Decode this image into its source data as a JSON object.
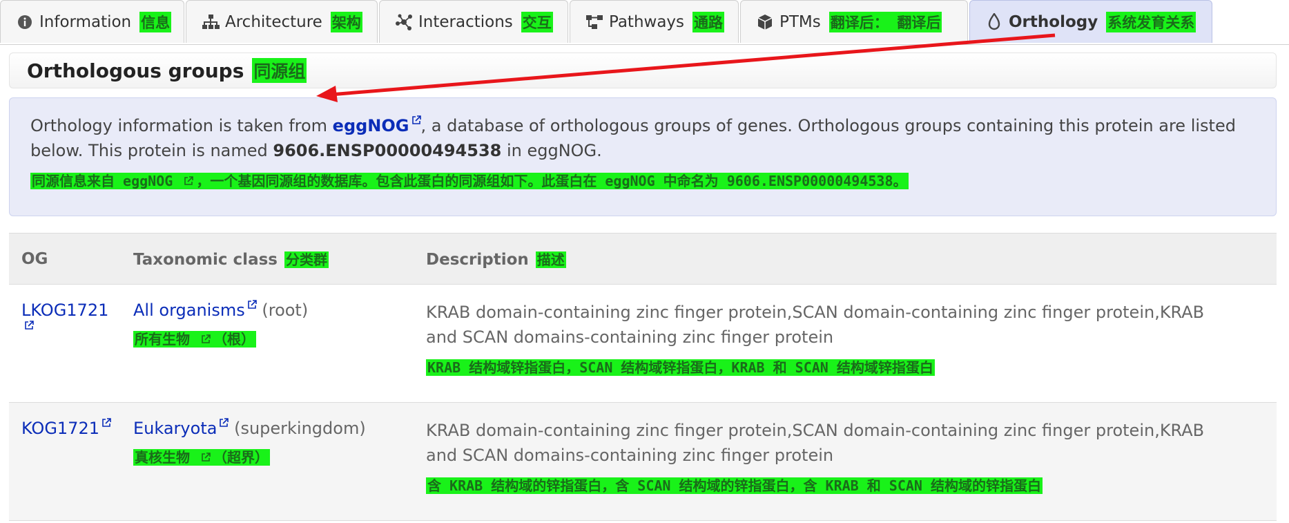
{
  "tabs": [
    {
      "label": "Information",
      "zh": "信息",
      "icon": "info-icon"
    },
    {
      "label": "Architecture",
      "zh": "架构",
      "icon": "architecture-icon"
    },
    {
      "label": "Interactions",
      "zh": "交互",
      "icon": "interactions-icon"
    },
    {
      "label": "Pathways",
      "zh": "通路",
      "icon": "pathways-icon"
    },
    {
      "label": "PTMs",
      "zh": "翻译后： 翻译后",
      "icon": "cube-icon"
    },
    {
      "label": "Orthology",
      "zh": "系统发育关系",
      "icon": "orthology-icon"
    }
  ],
  "header": {
    "title": "Orthologous groups",
    "zh": "同源组"
  },
  "info": {
    "prefix": "Orthology information is taken from ",
    "link": "eggNOG",
    "mid": ", a database of orthologous groups of genes. Orthologous groups containing this protein are listed below. This protein is named ",
    "protein_name": "9606.ENSP00000494538",
    "suffix": " in eggNOG.",
    "zh_a": "同源信息来自 eggNOG ",
    "zh_b": "，一个基因同源组的数据库。包含此蛋白的同源组如下。此蛋白在 eggNOG 中命名为 9606.ENSP00000494538。"
  },
  "table": {
    "headers": {
      "og": "OG",
      "tax": "Taxonomic class",
      "tax_zh": "分类群",
      "desc": "Description",
      "desc_zh": "描述"
    },
    "rows": [
      {
        "og": "LKOG1721",
        "tax": "All organisms",
        "tax_rank": "(root)",
        "tax_zh_a": "所有生物 ",
        "tax_zh_b": "（根）",
        "desc": "KRAB domain-containing zinc finger protein,SCAN domain-containing zinc finger protein,KRAB and SCAN domains-containing zinc finger protein",
        "desc_zh": "KRAB 结构域锌指蛋白，SCAN 结构域锌指蛋白，KRAB 和 SCAN 结构域锌指蛋白"
      },
      {
        "og": "KOG1721",
        "tax": "Eukaryota",
        "tax_rank": "(superkingdom)",
        "tax_zh_a": "真核生物 ",
        "tax_zh_b": "（超界）",
        "desc": "KRAB domain-containing zinc finger protein,SCAN domain-containing zinc finger protein,KRAB and SCAN domains-containing zinc finger protein",
        "desc_zh": "含 KRAB 结构域的锌指蛋白，含 SCAN 结构域的锌指蛋白，含 KRAB 和 SCAN 结构域的锌指蛋白"
      }
    ]
  },
  "colors": {
    "active_tab": "#dfe3f7",
    "link": "#0b2db8",
    "highlight": "#19f219",
    "arrow": "#e8161b"
  }
}
